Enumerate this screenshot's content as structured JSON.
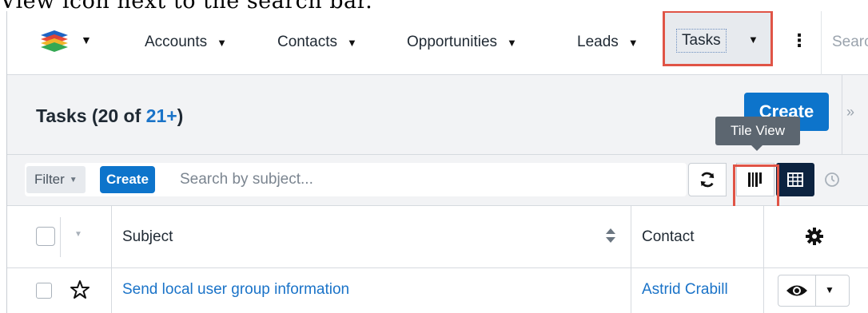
{
  "caption": {
    "text": "View icon next to the search bar."
  },
  "nav": {
    "items": [
      {
        "label": "Accounts"
      },
      {
        "label": "Contacts"
      },
      {
        "label": "Opportunities"
      },
      {
        "label": "Leads"
      },
      {
        "label": "Tasks"
      }
    ],
    "search_placeholder": "Search",
    "caret_glyph": "▼",
    "more_glyph": "⋮"
  },
  "header": {
    "title_prefix": "Tasks (",
    "count_shown": "20",
    "count_of": " of ",
    "count_total": "21+",
    "title_suffix": ")",
    "create_label": "Create",
    "collapse_glyph": "»"
  },
  "tooltip": {
    "text": "Tile View"
  },
  "filter": {
    "filter_label": "Filter",
    "create_label": "Create",
    "search_placeholder": "Search by subject..."
  },
  "list": {
    "columns": {
      "subject": "Subject",
      "contact": "Contact"
    },
    "rows": [
      {
        "subject": "Send local user group information",
        "contact": "Astrid Crabill"
      }
    ]
  },
  "colors": {
    "accent": "#0d74cb",
    "highlight": "#e05446",
    "active_view": "#0c2340"
  },
  "icons": [
    "logo-icon",
    "refresh-icon",
    "tile-view-icon",
    "table-view-icon",
    "timeline-icon",
    "sort-icon",
    "gear-icon",
    "star-icon",
    "eye-icon"
  ]
}
